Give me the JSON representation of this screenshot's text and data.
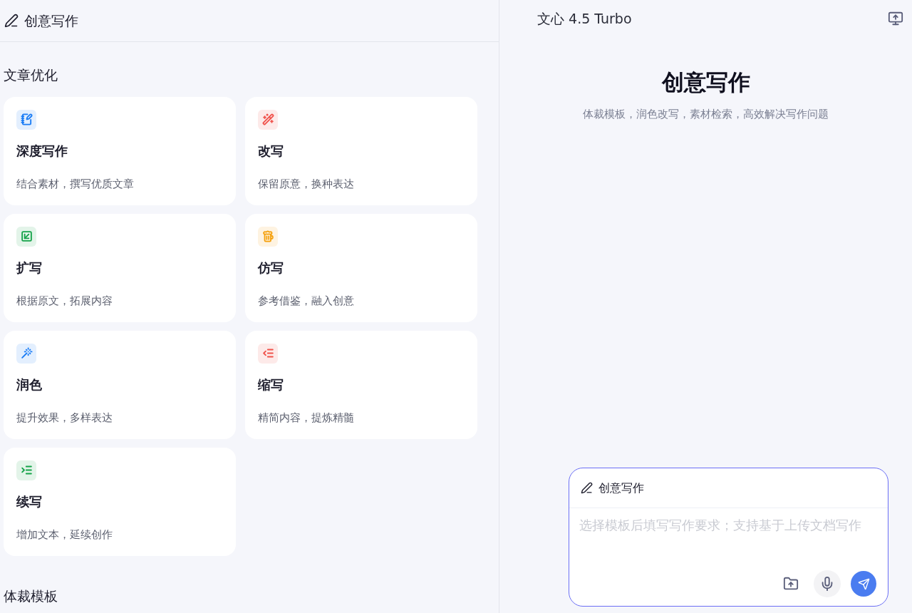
{
  "left_header": {
    "title": "创意写作"
  },
  "section": {
    "title": "文章优化"
  },
  "cards": [
    {
      "kind": "doc",
      "color": "#1a7cf5",
      "title": "深度写作",
      "description": "结合素材，撰写优质文章"
    },
    {
      "kind": "sparkle-pen",
      "color": "#f0524b",
      "title": "改写",
      "description": "保留原意，换种表达"
    },
    {
      "kind": "expand",
      "color": "#16a34a",
      "title": "扩写",
      "description": "根据原文，拓展内容"
    },
    {
      "kind": "mug",
      "color": "#f5a00b",
      "title": "仿写",
      "description": "参考借鉴，融入创意"
    },
    {
      "kind": "wand",
      "color": "#1a7cf5",
      "title": "润色",
      "description": "提升效果，多样表达"
    },
    {
      "kind": "shrink",
      "color": "#f0524b",
      "title": "缩写",
      "description": "精简内容，提炼精髓"
    },
    {
      "kind": "extend",
      "color": "#16a34a",
      "title": "续写",
      "description": "增加文本，延续创作"
    }
  ],
  "section_2": {
    "title": "体裁模板"
  },
  "right_header": {
    "model": "文心 4.5 Turbo"
  },
  "hero": {
    "title": "创意写作",
    "subtitle": "体裁模板，润色改写，素材检索，高效解决写作问题"
  },
  "composer": {
    "mode": "创意写作",
    "placeholder": "选择模板后填写写作要求；支持基于上传文档写作"
  }
}
